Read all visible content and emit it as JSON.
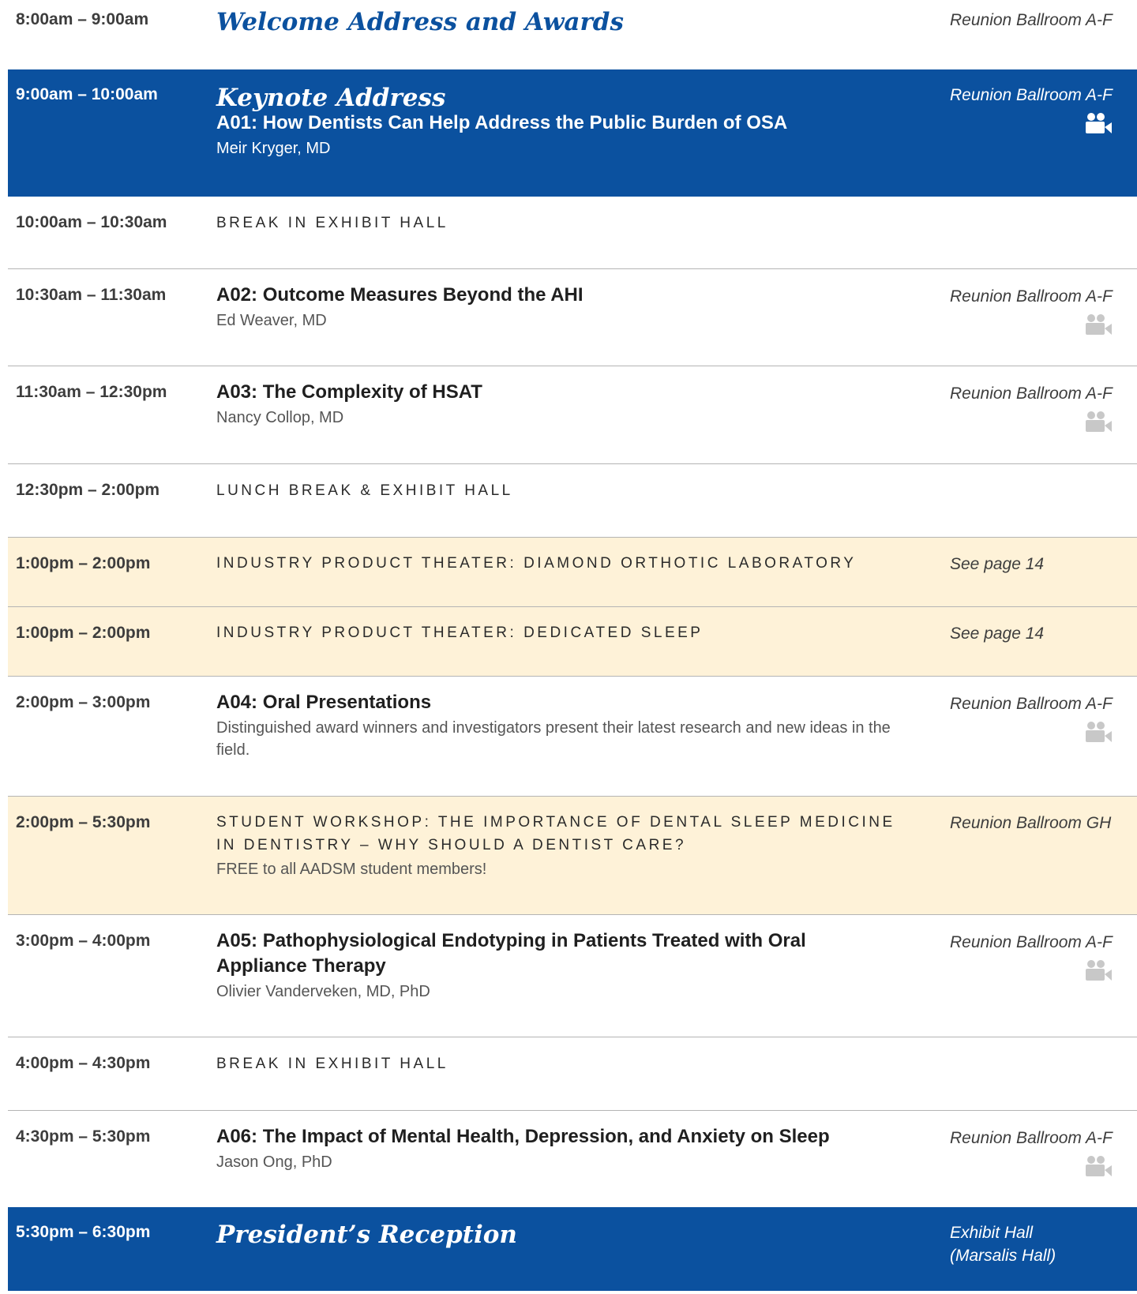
{
  "icons": {
    "camera": "video-camera-icon"
  },
  "colors": {
    "accent_blue": "#0b519f",
    "cream": "#fef2d8",
    "camera_gray": "#c8c8c8",
    "divider": "#b4b4b4"
  },
  "rows": [
    {
      "time": "8:00am – 9:00am",
      "title": "Welcome Address and Awards",
      "location": "Reunion Ballroom A-F"
    },
    {
      "time": "9:00am – 10:00am",
      "title": "Keynote Address",
      "session": "A01: How Dentists Can Help Address the Public Burden of OSA",
      "speaker": "Meir Kryger, MD",
      "location": "Reunion Ballroom A-F",
      "recorded": true
    },
    {
      "time": "10:00am – 10:30am",
      "label": "BREAK IN EXHIBIT HALL"
    },
    {
      "time": "10:30am – 11:30am",
      "session": "A02: Outcome Measures Beyond the AHI",
      "speaker": "Ed Weaver, MD",
      "location": "Reunion Ballroom A-F",
      "recorded": true
    },
    {
      "time": "11:30am – 12:30pm",
      "session": "A03: The Complexity of HSAT",
      "speaker": "Nancy Collop, MD",
      "location": "Reunion Ballroom A-F",
      "recorded": true
    },
    {
      "time": "12:30pm – 2:00pm",
      "label": "LUNCH BREAK & EXHIBIT HALL"
    },
    {
      "time": "1:00pm – 2:00pm",
      "label": "INDUSTRY PRODUCT THEATER: DIAMOND ORTHOTIC LABORATORY",
      "location": "See page 14"
    },
    {
      "time": "1:00pm – 2:00pm",
      "label": "INDUSTRY PRODUCT THEATER: DEDICATED SLEEP",
      "location": "See page 14"
    },
    {
      "time": "2:00pm – 3:00pm",
      "session": "A04: Oral Presentations",
      "description": "Distinguished award winners and investigators present their latest research and new ideas in the field.",
      "location": "Reunion Ballroom A-F",
      "recorded": true
    },
    {
      "time": "2:00pm – 5:30pm",
      "label_line1": "STUDENT WORKSHOP: THE IMPORTANCE OF DENTAL SLEEP MEDICINE",
      "label_line2": "IN DENTISTRY – WHY SHOULD A DENTIST CARE?",
      "note": "FREE to all AADSM student members!",
      "location": "Reunion Ballroom GH"
    },
    {
      "time": "3:00pm – 4:00pm",
      "session_line1": "A05: Pathophysiological Endotyping in Patients Treated with Oral",
      "session_line2": "Appliance Therapy",
      "speaker": "Olivier Vanderveken, MD, PhD",
      "location": "Reunion Ballroom A-F",
      "recorded": true
    },
    {
      "time": "4:00pm – 4:30pm",
      "label": "BREAK IN EXHIBIT HALL"
    },
    {
      "time": "4:30pm – 5:30pm",
      "session": "A06: The Impact of Mental Health, Depression, and Anxiety on Sleep",
      "speaker": "Jason Ong, PhD",
      "location": "Reunion Ballroom A-F",
      "recorded": true
    },
    {
      "time": "5:30pm – 6:30pm",
      "title": "President’s Reception",
      "location_line1": "Exhibit Hall",
      "location_line2": "(Marsalis Hall)"
    }
  ]
}
